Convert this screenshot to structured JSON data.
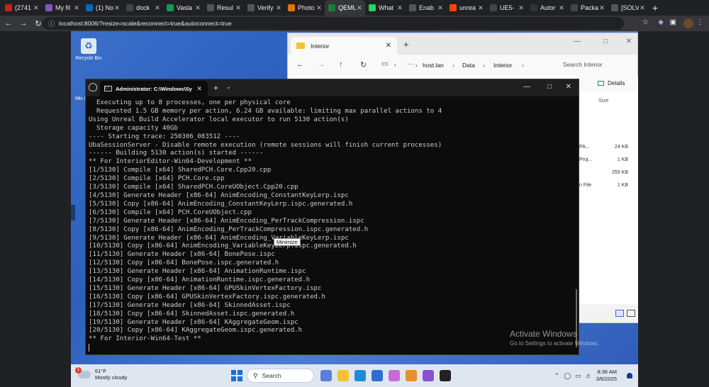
{
  "browser": {
    "tabs": [
      {
        "label": "(2741",
        "favicon": "gmail-icon",
        "color": "#c5221f"
      },
      {
        "label": "My fil",
        "favicon": "folder-icon",
        "color": "#7e57c2"
      },
      {
        "label": "(1) No",
        "favicon": "linkedin-icon",
        "color": "#0a66c2"
      },
      {
        "label": "dock",
        "favicon": "github-icon",
        "color": "#444"
      },
      {
        "label": "Vasla",
        "favicon": "sheets-icon",
        "color": "#0f9d58"
      },
      {
        "label": "Resul",
        "favicon": "page-icon",
        "color": "#555"
      },
      {
        "label": "Verify",
        "favicon": "page-icon",
        "color": "#555"
      },
      {
        "label": "Photo",
        "favicon": "pinwheel-icon",
        "color": "#e8710a"
      },
      {
        "label": "QEMU",
        "favicon": "qemu-icon",
        "color": "#1e7e34",
        "active": true
      },
      {
        "label": "What",
        "favicon": "whatsapp-icon",
        "color": "#25d366"
      },
      {
        "label": "Enab",
        "favicon": "page-icon",
        "color": "#555"
      },
      {
        "label": "unrea",
        "favicon": "reddit-icon",
        "color": "#ff4500"
      },
      {
        "label": "UE5-",
        "favicon": "github-icon",
        "color": "#444"
      },
      {
        "label": "Autor",
        "favicon": "m-icon",
        "color": "#333"
      },
      {
        "label": "Packa",
        "favicon": "github-icon",
        "color": "#444"
      },
      {
        "label": "[SOLV",
        "favicon": "page-icon",
        "color": "#555"
      }
    ],
    "url": "localhost:8006/?resize=scale&reconnect=true&autoconnect=true"
  },
  "desktop": {
    "recycle_bin_label": "Recycle Bin",
    "side_label": "Mic E"
  },
  "explorer": {
    "tab_title": "Interior",
    "breadcrumb": [
      "host.lan",
      "Data",
      "Interior"
    ],
    "search_placeholder": "Search Interior",
    "details_label": "Details",
    "size_header": "Size",
    "rows": [
      {
        "fragment": "PA...",
        "size": "24 KB"
      },
      {
        "fragment": "Proj...",
        "size": "1 KB"
      },
      {
        "fragment": "",
        "size": "255 KB"
      },
      {
        "fragment": "n File",
        "size": "1 KB"
      }
    ]
  },
  "terminal": {
    "tab_title": "Administrator: C:\\Windows\\Sy",
    "lines": [
      "  Executing up to 8 processes, one per physical core",
      "  Requested 1.5 GB memory per action, 6.24 GB available: limiting max parallel actions to 4",
      "Using Unreal Build Accelerator local executor to run 5130 action(s)",
      "  Storage capacity 40Gb",
      "---- Starting trace: 250306_083512 ----",
      "UbaSessionServer - Disable remote execution (remote sessions will finish current processes)",
      "------ Building 5130 action(s) started ------",
      "** For InteriorEditor-Win64-Development **",
      "[1/5130] Compile [x64] SharedPCH.Core.Cpp20.cpp",
      "[2/5130] Compile [x64] PCH.Core.cpp",
      "[3/5130] Compile [x64] SharedPCH.CoreUObject.Cpp20.cpp",
      "[4/5130] Generate Header [x86-64] AnimEncoding_ConstantKeyLerp.ispc",
      "[5/5130] Copy [x86-64] AnimEncoding_ConstantKeyLerp.ispc.generated.h",
      "[6/5130] Compile [x64] PCH.CoreUObject.cpp",
      "[7/5130] Generate Header [x86-64] AnimEncoding_PerTrackCompression.ispc",
      "[8/5130] Copy [x86-64] AnimEncoding_PerTrackCompression.ispc.generated.h",
      "[9/5130] Generate Header [x86-64] AnimEncoding_VariableKeyLerp.ispc",
      "[10/5130] Copy [x86-64] AnimEncoding_VariableKeyLerp.ispc.generated.h",
      "[11/5130] Generate Header [x86-64] BonePose.ispc",
      "[12/5130] Copy [x86-64] BonePose.ispc.generated.h",
      "[13/5130] Generate Header [x86-64] AnimationRuntime.ispc",
      "[14/5130] Copy [x86-64] AnimationRuntime.ispc.generated.h",
      "[15/5130] Generate Header [x86-64] GPUSkinVertexFactory.ispc",
      "[16/5130] Copy [x86-64] GPUSkinVertexFactory.ispc.generated.h",
      "[17/5130] Generate Header [x86-64] SkinnedAsset.ispc",
      "[18/5130] Copy [x86-64] SkinnedAsset.ispc.generated.h",
      "[19/5130] Generate Header [x86-64] KAggregateGeom.ispc",
      "[20/5130] Copy [x86-64] KAggregateGeom.ispc.generated.h",
      "** For Interior-Win64-Test **"
    ],
    "tooltip": "Minimize"
  },
  "watermark": {
    "title": "Activate Windows",
    "subtitle": "Go to Settings to activate Windows."
  },
  "taskbar": {
    "weather_badge": "1",
    "temperature": "61°F",
    "condition": "Mostly cloudy",
    "search_label": "Search",
    "time": "8:36 AM",
    "date": "3/6/2025",
    "apps": [
      {
        "name": "widgets-icon",
        "color": "#5b7fd8"
      },
      {
        "name": "file-explorer-icon",
        "color": "#f4c430"
      },
      {
        "name": "edge-icon",
        "color": "#1e8bd6"
      },
      {
        "name": "store-icon",
        "color": "#2d6fd0"
      },
      {
        "name": "copilot-icon",
        "color": "#c86ad8"
      },
      {
        "name": "pinwheel-icon",
        "color": "#e88e2a"
      },
      {
        "name": "visual-studio-icon",
        "color": "#8c4fd1"
      },
      {
        "name": "terminal-icon",
        "color": "#222"
      }
    ]
  }
}
